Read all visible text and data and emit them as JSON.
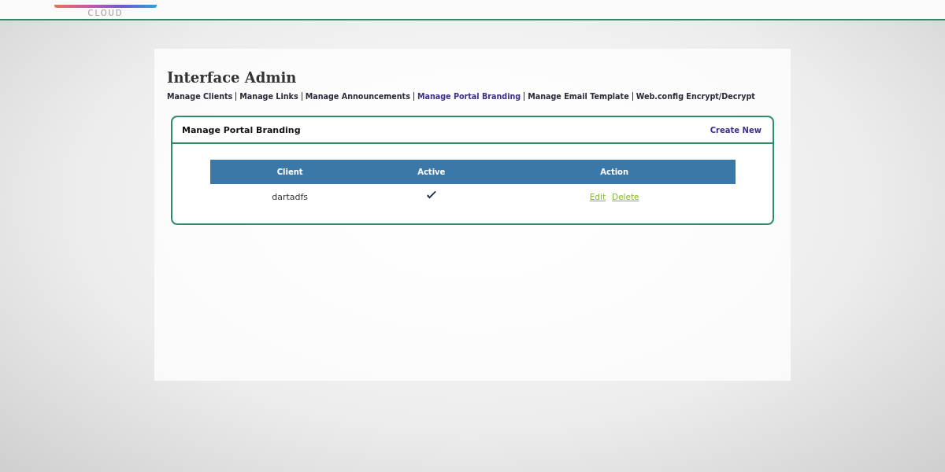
{
  "header": {
    "logo_subtitle": "CLOUD"
  },
  "page": {
    "title": "Interface Admin"
  },
  "nav": [
    {
      "label": "Manage Clients",
      "selected": false
    },
    {
      "label": "Manage Links",
      "selected": false
    },
    {
      "label": "Manage Announcements",
      "selected": false
    },
    {
      "label": "Manage Portal Branding",
      "selected": true
    },
    {
      "label": "Manage Email Template",
      "selected": false
    },
    {
      "label": "Web.config Encrypt/Decrypt",
      "selected": false
    }
  ],
  "card": {
    "title": "Manage Portal Branding",
    "action": "Create New"
  },
  "table": {
    "columns": [
      "Client",
      "Active",
      "Action"
    ],
    "rows": [
      {
        "client": "dartadfs",
        "active": true,
        "actions": [
          "Edit",
          "Delete"
        ]
      }
    ]
  }
}
